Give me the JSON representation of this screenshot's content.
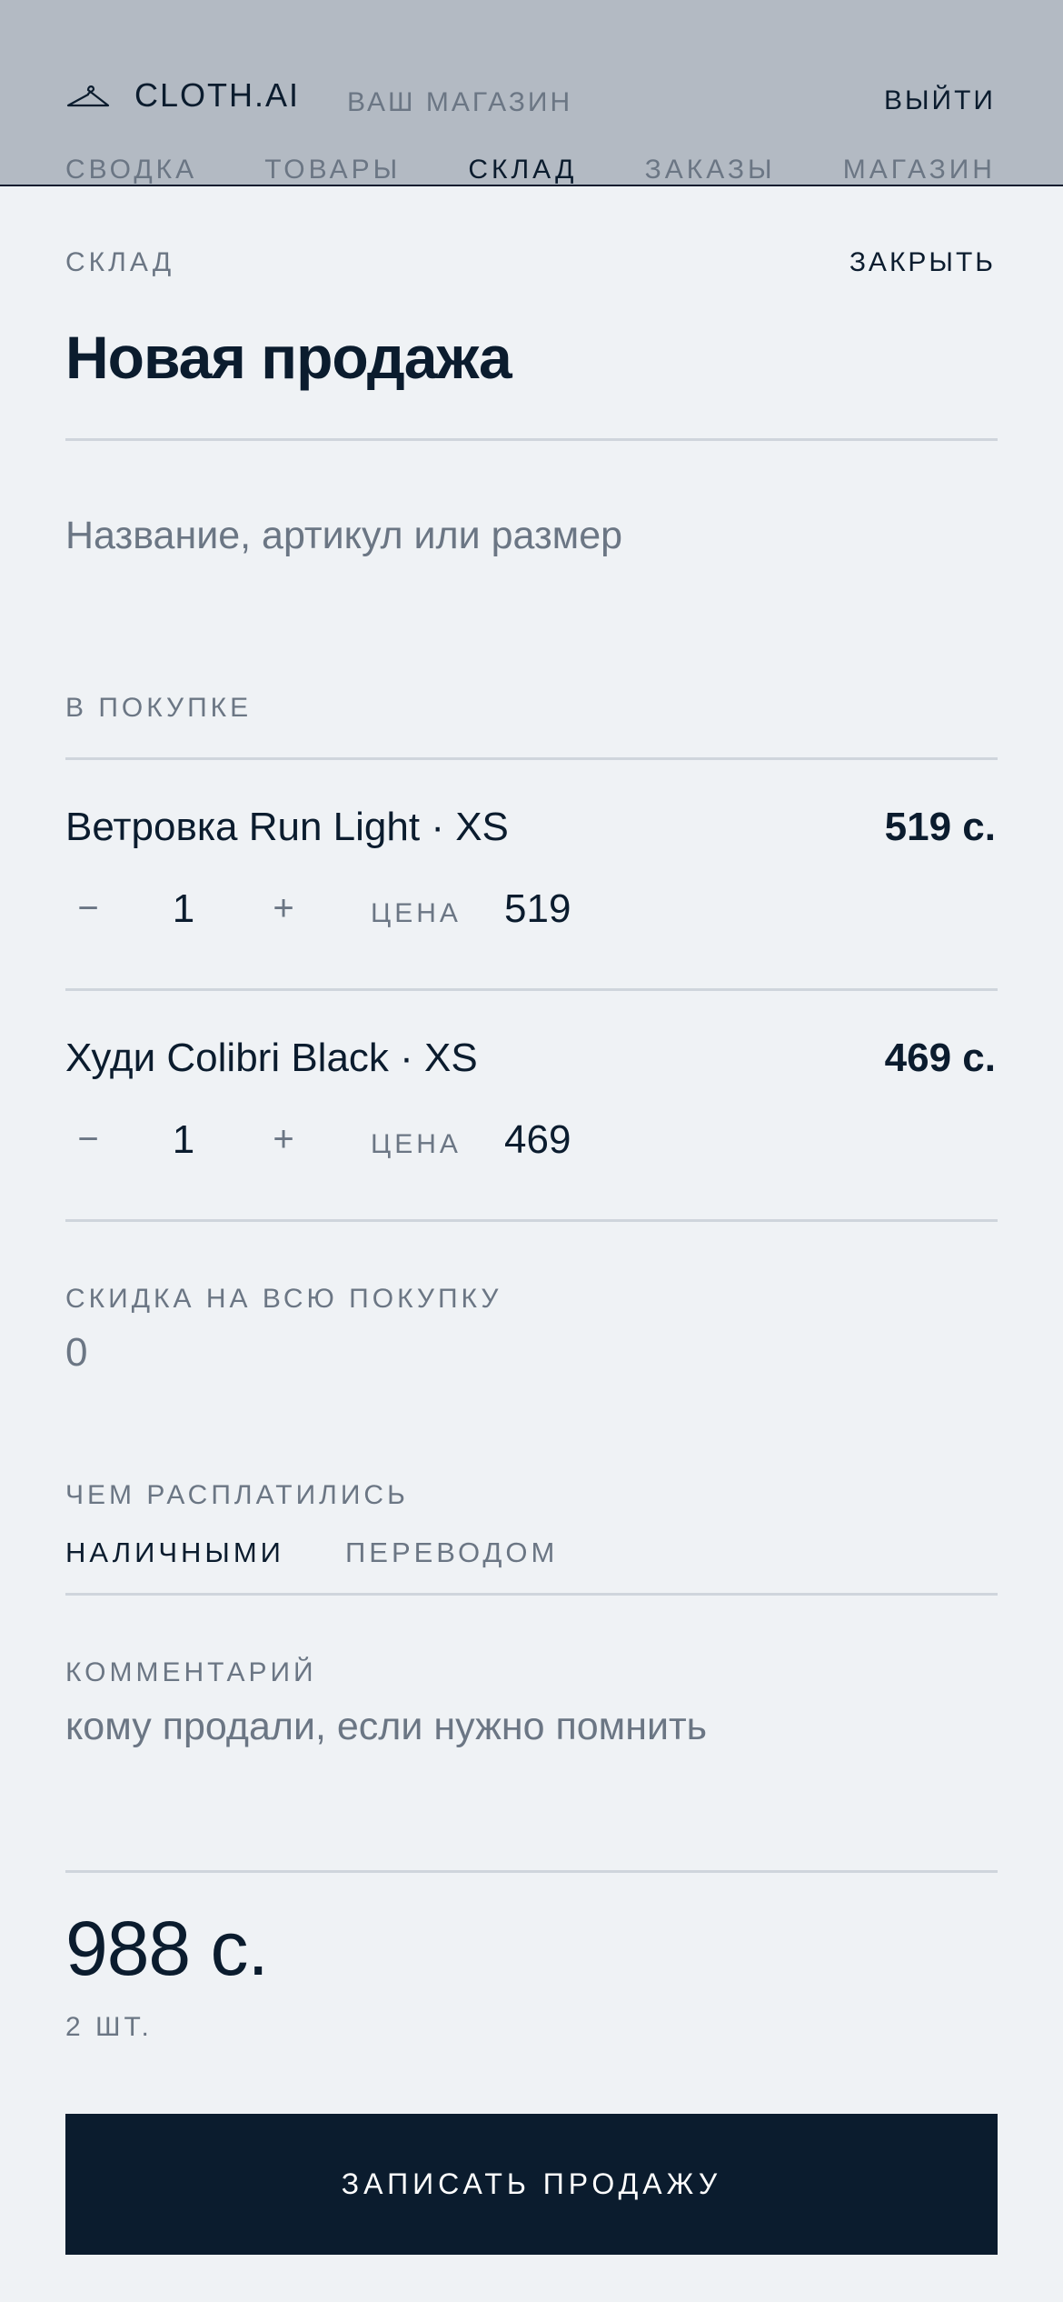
{
  "header": {
    "brand": "CLOTH.AI",
    "shop_label": "ВАШ МАГАЗИН",
    "logout": "ВЫЙТИ",
    "tabs": [
      {
        "label": "СВОДКА"
      },
      {
        "label": "ТОВАРЫ"
      },
      {
        "label": "СКЛАД"
      },
      {
        "label": "ЗАКАЗЫ"
      },
      {
        "label": "МАГАЗИН"
      }
    ],
    "active_tab": "СКЛАД"
  },
  "panel": {
    "section": "СКЛАД",
    "close": "ЗАКРЫТЬ",
    "title": "Новая продажа",
    "search_placeholder": "Название, артикул или размер"
  },
  "cart": {
    "label": "В ПОКУПКЕ",
    "items": [
      {
        "name": "Ветровка Run Light · XS",
        "total": "519 с.",
        "minus": "−",
        "qty": "1",
        "plus": "+",
        "price_label": "ЦЕНА",
        "price": "519"
      },
      {
        "name": "Худи Colibri Black · XS",
        "total": "469 с.",
        "minus": "−",
        "qty": "1",
        "plus": "+",
        "price_label": "ЦЕНА",
        "price": "469"
      }
    ]
  },
  "discount": {
    "label": "СКИДКА НА ВСЮ ПОКУПКУ",
    "value": "0"
  },
  "payment": {
    "label": "ЧЕМ РАСПЛАТИЛИСЬ",
    "options": [
      "НАЛИЧНЫМИ",
      "ПЕРЕВОДОМ"
    ],
    "selected": "НАЛИЧНЫМИ"
  },
  "comment": {
    "label": "КОММЕНТАРИЙ",
    "placeholder": "кому продали, если нужно помнить"
  },
  "summary": {
    "total": "988 с.",
    "count": "2 ШТ."
  },
  "submit_label": "ЗАПИСАТЬ ПРОДАЖУ",
  "colors": {
    "header_bg": "#b3bac3",
    "page_bg": "#eff2f5",
    "ink": "#0b1c2e",
    "muted": "#6b7684",
    "divider": "#cfd5dc"
  }
}
